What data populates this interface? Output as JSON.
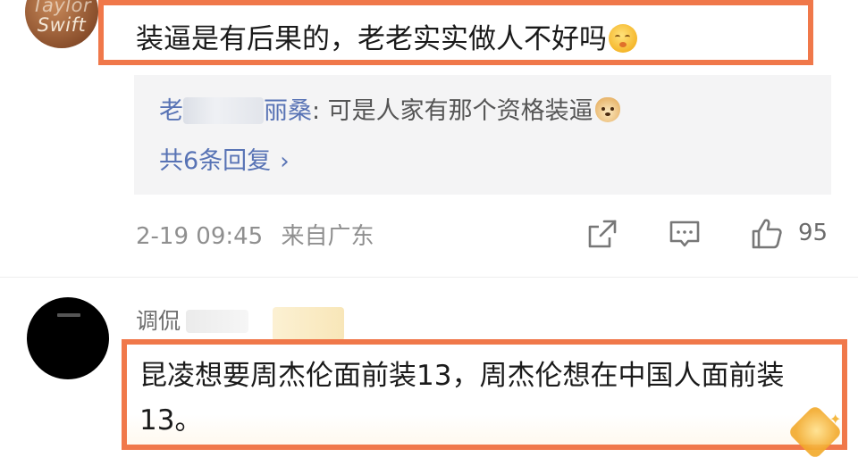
{
  "comment1": {
    "avatar_text_top": "Taylor",
    "avatar_text_bottom": "Swift",
    "text": "装逼是有后果的，老老实实做人不好吗"
  },
  "reply": {
    "name_prefix": "老",
    "name_suffix": "丽桑",
    "text": ": 可是人家有那个资格装逼",
    "more_label": "共6条回复",
    "more_chevron": "›"
  },
  "meta": {
    "timestamp": "2-19 09:45",
    "location": "来自广东"
  },
  "actions": {
    "like_count": "95"
  },
  "comment2": {
    "name": "调侃",
    "text": "昆凌想要周杰伦面前装13，周杰伦想在中国人面前装13。"
  },
  "icons": {
    "share": "share-icon",
    "comment": "comment-icon",
    "like": "thumbs-up-icon"
  },
  "colors": {
    "highlight": "#f0784a",
    "link": "#5873b5",
    "reply_bg": "#f4f4f5"
  }
}
